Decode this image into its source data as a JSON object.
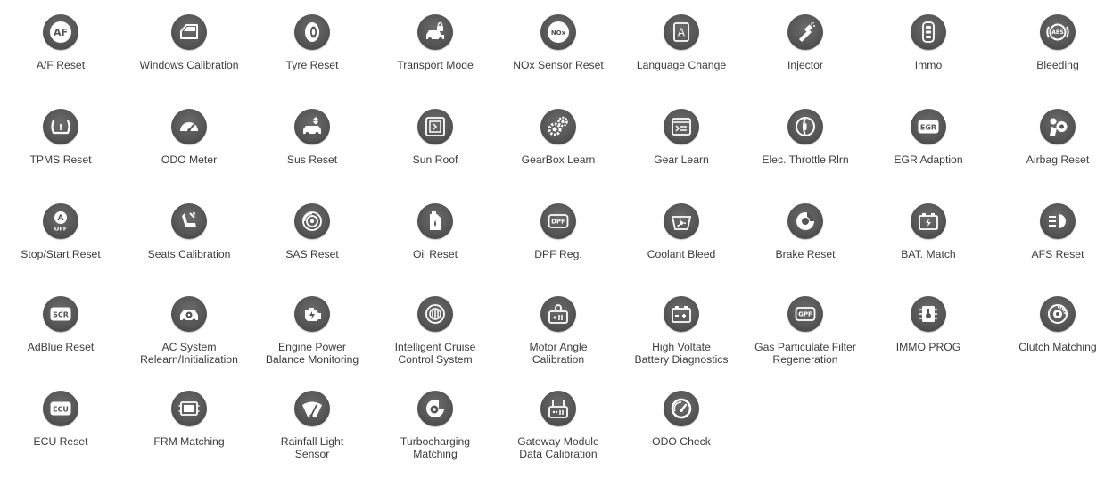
{
  "colors": {
    "icon_circle": "#545454",
    "icon_glyph": "#ffffff",
    "label_text": "#3c3c3c",
    "background": "#ffffff"
  },
  "functions": [
    {
      "label": "A/F Reset",
      "icon": "af-icon",
      "text": "AF"
    },
    {
      "label": "Windows Calibration",
      "icon": "car-door-icon"
    },
    {
      "label": "Tyre Reset",
      "icon": "tyre-icon"
    },
    {
      "label": "Transport Mode",
      "icon": "car-lock-icon"
    },
    {
      "label": "NOx Sensor Reset",
      "icon": "nox-icon",
      "text": "NOx"
    },
    {
      "label": "Language Change",
      "icon": "language-icon",
      "text": "A"
    },
    {
      "label": "Injector",
      "icon": "injector-icon"
    },
    {
      "label": "Immo",
      "icon": "key-fob-icon"
    },
    {
      "label": "Bleeding",
      "icon": "abs-icon",
      "text": "ABS"
    },
    {
      "label": "TPMS Reset",
      "icon": "tpms-icon"
    },
    {
      "label": "ODO Meter",
      "icon": "odometer-icon"
    },
    {
      "label": "Sus Reset",
      "icon": "suspension-car-icon"
    },
    {
      "label": "Sun Roof",
      "icon": "sunroof-icon"
    },
    {
      "label": "GearBox Learn",
      "icon": "gears-icon"
    },
    {
      "label": "Gear Learn",
      "icon": "gear-window-icon"
    },
    {
      "label": "Elec. Throttle Rlrn",
      "icon": "throttle-icon"
    },
    {
      "label": "EGR Adaption",
      "icon": "egr-icon",
      "text": "EGR"
    },
    {
      "label": "Airbag Reset",
      "icon": "airbag-icon"
    },
    {
      "label": "Stop/Start Reset",
      "icon": "stop-start-icon",
      "text": "A",
      "subtext": "OFF"
    },
    {
      "label": "Seats Calibration",
      "icon": "seat-icon"
    },
    {
      "label": "SAS Reset",
      "icon": "steering-angle-icon"
    },
    {
      "label": "Oil Reset",
      "icon": "oil-can-icon"
    },
    {
      "label": "DPF Reg.",
      "icon": "dpf-icon",
      "text": "DPF"
    },
    {
      "label": "Coolant Bleed",
      "icon": "coolant-fan-icon"
    },
    {
      "label": "Brake Reset",
      "icon": "brake-disc-icon"
    },
    {
      "label": "BAT. Match",
      "icon": "battery-icon"
    },
    {
      "label": "AFS Reset",
      "icon": "headlight-icon"
    },
    {
      "label": "AdBlue Reset",
      "icon": "scr-icon",
      "text": "SCR"
    },
    {
      "label": "AC System\nRelearn/Initialization",
      "icon": "ac-car-icon"
    },
    {
      "label": "Engine Power\nBalance Monitoring",
      "icon": "engine-icon"
    },
    {
      "label": "Intelligent Cruise\nControl System",
      "icon": "cruise-control-icon"
    },
    {
      "label": "Motor Angle\nCalibration",
      "icon": "motor-angle-icon"
    },
    {
      "label": "High Voltate\nBattery Diagnostics",
      "icon": "hv-battery-icon"
    },
    {
      "label": "Gas Particulate Filter\nRegeneration",
      "icon": "gpf-icon",
      "text": "GPF"
    },
    {
      "label": "IMMO PROG",
      "icon": "immo-chip-icon"
    },
    {
      "label": "Clutch Matching",
      "icon": "clutch-icon"
    },
    {
      "label": "ECU Reset",
      "icon": "ecu-icon",
      "text": "ECU"
    },
    {
      "label": "FRM Matching",
      "icon": "frm-module-icon"
    },
    {
      "label": "Rainfall Light\nSensor",
      "icon": "wiper-icon"
    },
    {
      "label": "Turbocharging\nMatching",
      "icon": "turbo-icon"
    },
    {
      "label": "Gateway Module\nData Calibration",
      "icon": "gateway-icon"
    },
    {
      "label": "ODO Check",
      "icon": "gauge-icon"
    }
  ]
}
